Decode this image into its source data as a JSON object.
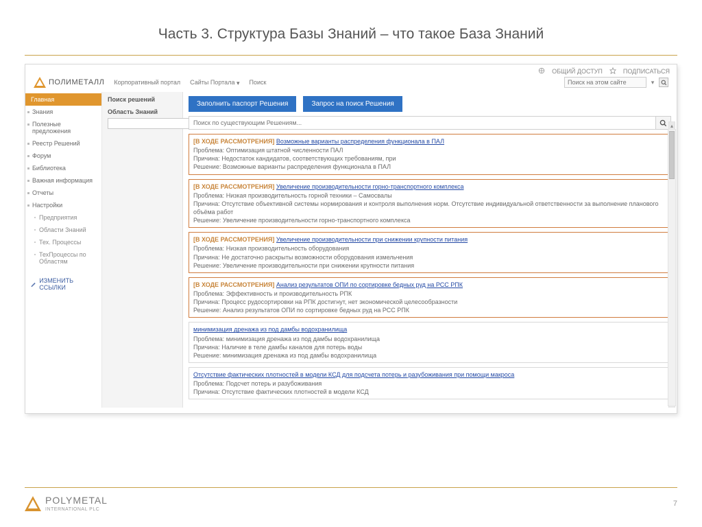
{
  "slide": {
    "title": "Часть 3. Структура Базы Знаний – что такое База Знаний",
    "page_number": "7"
  },
  "footer_logo": {
    "name": "POLYMETAL",
    "sub": "INTERNATIONAL PLC"
  },
  "top": {
    "share": "ОБЩИЙ ДОСТУП",
    "subscribe": "ПОДПИСАТЬСЯ"
  },
  "header": {
    "logo": "ПОЛИМЕТАЛЛ",
    "nav": [
      "Корпоративный портал",
      "Сайты Портала",
      "Поиск"
    ],
    "search_placeholder": "Поиск на этом сайте"
  },
  "sidebar": {
    "active": "Главная",
    "items": [
      "Знания",
      "Полезные предложения",
      "Реестр Решений",
      "Форум",
      "Библиотека",
      "Важная информация",
      "Отчеты",
      "Настройки"
    ],
    "subitems": [
      "Предприятия",
      "Области Знаний",
      "Тех. Процессы",
      "ТехПроцессы по Областям"
    ],
    "edit_links": "ИЗМЕНИТЬ ССЫЛКИ"
  },
  "mid": {
    "pane_title": "Поиск решений",
    "field_label": "Область Знаний"
  },
  "main": {
    "btn_fill": "Заполнить паспорт Решения",
    "btn_request": "Запрос на поиск Решения",
    "search_placeholder": "Поиск по существующим Решениям...",
    "status_label": "[В ХОДЕ РАССМОТРЕНИЯ]",
    "labels": {
      "problem": "Проблема:",
      "reason": "Причина:",
      "solution": "Решение:"
    },
    "cards": [
      {
        "hi": true,
        "title": "Возможные варианты распределения функционала в ПАЛ",
        "problem": "Оптимизация штатной численности ПАЛ",
        "reason": "Недостаток кандидатов, соответствующих требованиям, при",
        "solution": "Возможные варианты распределения функционала в ПАЛ"
      },
      {
        "hi": true,
        "title": "Увеличение производительности горно-транспортного комплекса",
        "problem": "Низкая производительность горной техники – Самосвалы",
        "reason": "Отсутствие объективной системы нормирования и контроля выполнения норм. Отсутствие индивидуальной ответственности за выполнение планового объёма работ",
        "solution": "Увеличение производительности горно-транспортного комплекса"
      },
      {
        "hi": true,
        "title": "Увеличение производительности при снижении крупности питания",
        "problem": "Низкая производительность оборудования",
        "reason": "Не достаточно раскрыты возможности оборудования измельчения",
        "solution": "Увеличение производительности при снижении крупности питания"
      },
      {
        "hi": true,
        "title": "Анализ результатов ОПИ по сортировке бедных руд на РСС РПК",
        "problem": "Эффективность и производительность РПК",
        "reason": "Процесс рудосортировки на РПК достигнут, нет экономической целесообразности",
        "solution": "Анализ результатов ОПИ по сортировке бедных руд на РСС РПК"
      },
      {
        "hi": false,
        "title": "минимизация дренажа из под дамбы водохранилища",
        "problem": "минимизация дренажа из под дамбы водохранилища",
        "reason": "Наличие в теле дамбы каналов для потерь воды",
        "solution": "минимизация дренажа из под дамбы водохранилища"
      },
      {
        "hi": false,
        "title": "Отсутствие фактических плотностей в модели КСД для подсчета потерь и разубоживания при помощи макроса",
        "problem": "Подсчет потерь и разубоживания",
        "reason": "Отсутствие фактических плотностей в модели КСД",
        "solution": ""
      }
    ]
  }
}
